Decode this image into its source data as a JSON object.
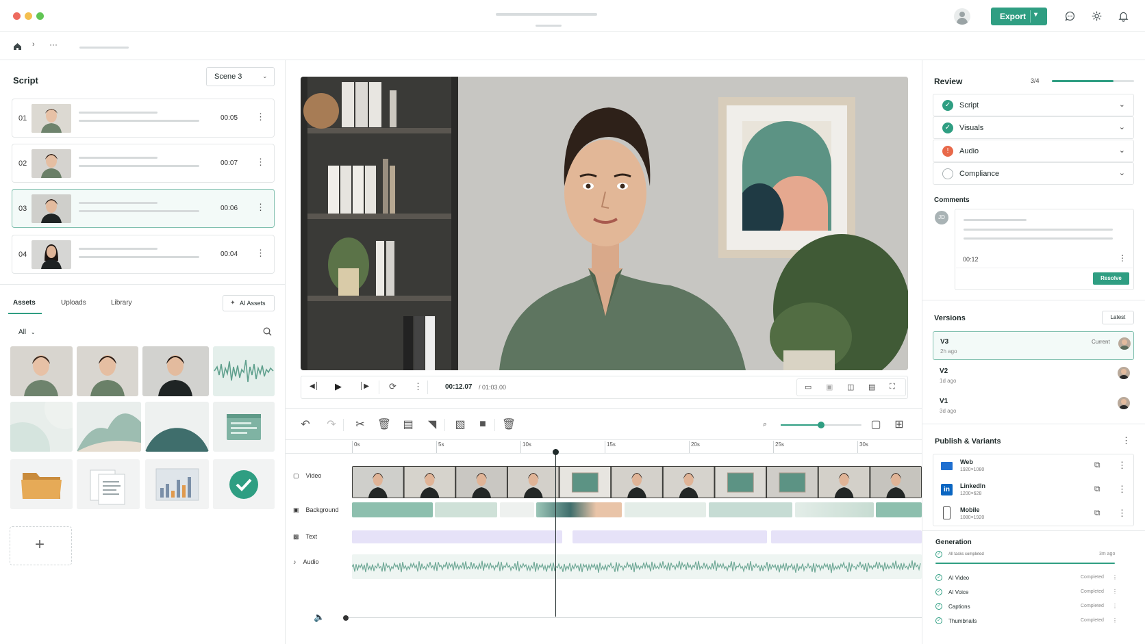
{
  "window": {
    "export_label": "Export"
  },
  "script_panel": {
    "title": "Script",
    "scene_select": "Scene 3",
    "scenes": [
      {
        "num": "01",
        "duration": "00:05"
      },
      {
        "num": "02",
        "duration": "00:07"
      },
      {
        "num": "03",
        "duration": "00:06"
      },
      {
        "num": "04",
        "duration": "00:04"
      }
    ]
  },
  "assets": {
    "tabs": [
      "Assets",
      "Uploads",
      "Library"
    ],
    "ai_button": "AI Assets",
    "filter": "All"
  },
  "player": {
    "current_time": "00:12.07",
    "total_time": "/ 01:03.00"
  },
  "timeline": {
    "ruler": [
      "0s",
      "5s",
      "10s",
      "15s",
      "20s",
      "25s",
      "30s"
    ],
    "tracks": [
      "Video",
      "Background",
      "Text",
      "Audio"
    ],
    "zoom": 0.5,
    "playhead_seconds": 12.07
  },
  "review": {
    "title": "Review",
    "progress_text": "3/4",
    "progress": 0.75,
    "items": [
      {
        "label": "Script",
        "status": "done"
      },
      {
        "label": "Visuals",
        "status": "done"
      },
      {
        "label": "Audio",
        "status": "warning"
      },
      {
        "label": "Compliance",
        "status": "pending"
      }
    ]
  },
  "comments": {
    "title": "Comments",
    "avatar": "JD",
    "timestamp": "00:12",
    "resolve_label": "Resolve"
  },
  "versions": {
    "title": "Versions",
    "latest_label": "Latest",
    "items": [
      {
        "name": "V3",
        "time": "2h ago",
        "tag": "Current"
      },
      {
        "name": "V2",
        "time": "1d ago",
        "tag": ""
      },
      {
        "name": "V1",
        "time": "3d ago",
        "tag": ""
      }
    ]
  },
  "publish": {
    "title": "Publish & Variants",
    "items": [
      {
        "name": "Web",
        "size": "1920×1080"
      },
      {
        "name": "LinkedIn",
        "size": "1200×628"
      },
      {
        "name": "Mobile",
        "size": "1080×1920"
      }
    ]
  },
  "generation": {
    "title": "Generation",
    "summary": "All tasks completed",
    "time": "3m ago",
    "tasks": [
      {
        "label": "AI Video",
        "status": "Completed"
      },
      {
        "label": "AI Voice",
        "status": "Completed"
      },
      {
        "label": "Captions",
        "status": "Completed"
      },
      {
        "label": "Thumbnails",
        "status": "Completed"
      }
    ]
  },
  "colors": {
    "accent": "#2f9e82",
    "warning": "#e8694a"
  }
}
